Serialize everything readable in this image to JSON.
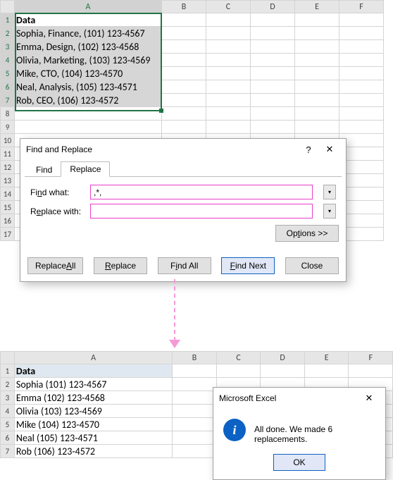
{
  "sheet1": {
    "columns": [
      "A",
      "B",
      "C",
      "D",
      "E",
      "F"
    ],
    "header_label": "Data",
    "rows": [
      "Sophia, Finance, (101) 123-4567",
      "Emma, Design, (102) 123-4568",
      "Olivia, Marketing, (103) 123-4569",
      "Mike, CTO, (104) 123-4570",
      "Neal, Analysis, (105) 123-4571",
      "Rob, CEO, (106) 123-4572"
    ],
    "row_numbers": [
      "1",
      "2",
      "3",
      "4",
      "5",
      "6",
      "7",
      "8",
      "9",
      "10",
      "11",
      "12",
      "13",
      "14",
      "15",
      "16",
      "17"
    ]
  },
  "sheet2": {
    "columns": [
      "A",
      "B",
      "C",
      "D",
      "E",
      "F"
    ],
    "header_label": "Data",
    "rows": [
      "Sophia (101) 123-4567",
      "Emma (102) 123-4568",
      "Olivia (103) 123-4569",
      "Mike (104) 123-4570",
      "Neal (105) 123-4571",
      "Rob (106) 123-4572"
    ],
    "row_numbers": [
      "1",
      "2",
      "3",
      "4",
      "5",
      "6",
      "7"
    ]
  },
  "dialog": {
    "title": "Find and Replace",
    "help": "?",
    "close_glyph": "✕",
    "tabs": {
      "find": "Find",
      "replace": "Replace"
    },
    "find_label_pre": "Fi",
    "find_label_u": "n",
    "find_label_post": "d what:",
    "replace_label_pre": "R",
    "replace_label_u": "e",
    "replace_label_post": "place with:",
    "find_value": ",*,",
    "replace_value": "",
    "options_pre": "Op",
    "options_u": "t",
    "options_post": "ions >>",
    "btns": {
      "replace_all_pre": "Replace ",
      "replace_all_u": "A",
      "replace_all_post": "ll",
      "replace_u": "R",
      "replace_post": "eplace",
      "find_all_pre": "F",
      "find_all_u": "i",
      "find_all_post": "nd All",
      "find_next_u": "F",
      "find_next_post": "ind Next",
      "close": "Close"
    }
  },
  "msgbox": {
    "title": "Microsoft Excel",
    "close_glyph": "✕",
    "info_glyph": "i",
    "text": "All done. We made 6 replacements.",
    "ok": "OK"
  },
  "dd_glyph": "▾"
}
